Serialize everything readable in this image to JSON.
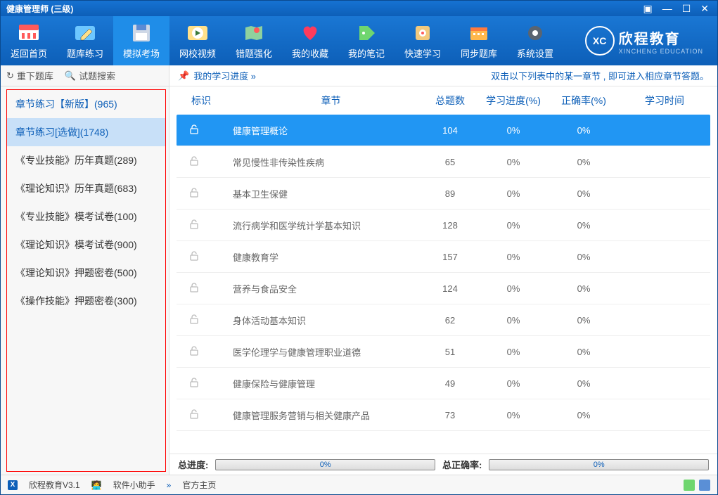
{
  "window": {
    "title": "健康管理师 (三级)"
  },
  "toolbar": {
    "items": [
      "返回首页",
      "题库练习",
      "模拟考场",
      "网校视频",
      "错题强化",
      "我的收藏",
      "我的笔记",
      "快速学习",
      "同步题库",
      "系统设置"
    ]
  },
  "brand": {
    "name": "欣程教育",
    "sub": "XINCHENG EDUCATION"
  },
  "sidebar": {
    "toolbar": {
      "reload": "重下题库",
      "search": "试题搜索"
    },
    "items": [
      "章节练习【新版】(965)",
      "章节练习[选做](1748)",
      "《专业技能》历年真题(289)",
      "《理论知识》历年真题(683)",
      "《专业技能》模考试卷(100)",
      "《理论知识》模考试卷(900)",
      "《理论知识》押题密卷(500)",
      "《操作技能》押题密卷(300)"
    ]
  },
  "main": {
    "breadcrumb": "我的学习进度 »",
    "hint": "双击以下列表中的某一章节 , 即可进入相应章节答题。",
    "columns": [
      "标识",
      "章节",
      "总题数",
      "学习进度(%)",
      "正确率(%)",
      "学习时间"
    ],
    "rows": [
      {
        "chapter": "健康管理概论",
        "total": "104",
        "progress": "0%",
        "accuracy": "0%",
        "time": "",
        "highlight": true
      },
      {
        "chapter": "常见慢性非传染性疾病",
        "total": "65",
        "progress": "0%",
        "accuracy": "0%",
        "time": ""
      },
      {
        "chapter": "基本卫生保健",
        "total": "89",
        "progress": "0%",
        "accuracy": "0%",
        "time": ""
      },
      {
        "chapter": "流行病学和医学统计学基本知识",
        "total": "128",
        "progress": "0%",
        "accuracy": "0%",
        "time": ""
      },
      {
        "chapter": "健康教育学",
        "total": "157",
        "progress": "0%",
        "accuracy": "0%",
        "time": ""
      },
      {
        "chapter": "营养与食品安全",
        "total": "124",
        "progress": "0%",
        "accuracy": "0%",
        "time": ""
      },
      {
        "chapter": "身体活动基本知识",
        "total": "62",
        "progress": "0%",
        "accuracy": "0%",
        "time": ""
      },
      {
        "chapter": "医学伦理学与健康管理职业道德",
        "total": "51",
        "progress": "0%",
        "accuracy": "0%",
        "time": ""
      },
      {
        "chapter": "健康保险与健康管理",
        "total": "49",
        "progress": "0%",
        "accuracy": "0%",
        "time": ""
      },
      {
        "chapter": "健康管理服务营销与相关健康产品",
        "total": "73",
        "progress": "0%",
        "accuracy": "0%",
        "time": ""
      }
    ],
    "overall": {
      "progress_label": "总进度:",
      "progress_value": "0%",
      "accuracy_label": "总正确率:",
      "accuracy_value": "0%"
    }
  },
  "status": {
    "app": "欣程教育V3.1",
    "helper": "软件小助手",
    "homepage": "官方主页"
  }
}
